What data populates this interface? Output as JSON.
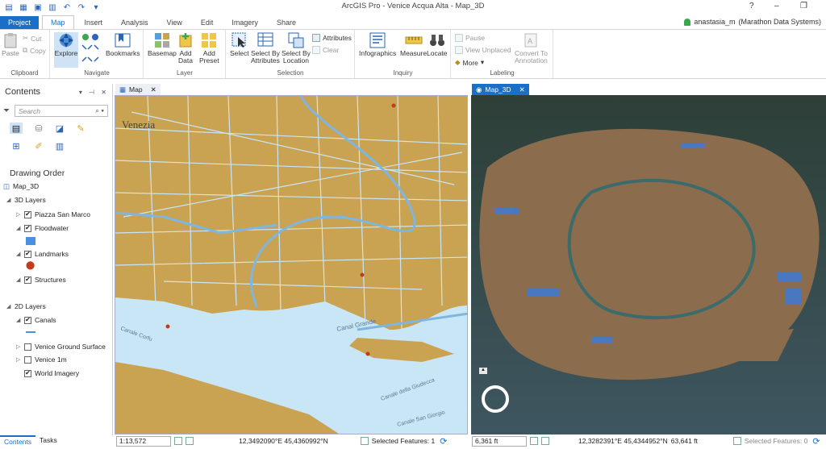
{
  "window": {
    "title": "ArcGIS Pro - Venice Acqua Alta - Map_3D",
    "help": "?",
    "minimize": "–",
    "restore": "❐"
  },
  "ribbon_tabs": [
    "Project",
    "Map",
    "Insert",
    "Analysis",
    "View",
    "Edit",
    "Imagery",
    "Share"
  ],
  "active_tab": "Map",
  "user": {
    "name": "anastasia_m",
    "org": "Marathon Data Systems"
  },
  "clipboard": {
    "paste": "Paste",
    "cut": "Cut",
    "copy": "Copy",
    "label": "Clipboard"
  },
  "navigate": {
    "explore": "Explore",
    "bookmarks": "Bookmarks",
    "label": "Navigate"
  },
  "layer": {
    "basemap": "Basemap",
    "add_data_1": "Add",
    "add_data_2": "Data",
    "add_preset_1": "Add",
    "add_preset_2": "Preset",
    "label": "Layer"
  },
  "selection": {
    "select": "Select",
    "select_by_attr_1": "Select By",
    "select_by_attr_2": "Attributes",
    "select_by_loc_1": "Select By",
    "select_by_loc_2": "Location",
    "attributes": "Attributes",
    "clear": "Clear",
    "label": "Selection"
  },
  "inquiry": {
    "infographics": "Infographics",
    "measure": "Measure",
    "locate": "Locate",
    "label": "Inquiry"
  },
  "labeling": {
    "pause": "Pause",
    "view_unplaced": "View Unplaced",
    "more": "More",
    "convert_1": "Convert To",
    "convert_2": "Annotation",
    "label": "Labeling"
  },
  "contents": {
    "title": "Contents",
    "search_placeholder": "Search",
    "drawing_order": "Drawing Order",
    "map_name": "Map_3D",
    "section_3d": "3D Layers",
    "section_2d": "2D Layers",
    "layers_3d": [
      "Piazza San Marco",
      "Floodwater",
      "Landmarks",
      "Structures"
    ],
    "layers_2d": [
      "Canals",
      "Venice Ground Surface",
      "Venice 1m",
      "World Imagery"
    ],
    "tab_contents": "Contents",
    "tab_tasks": "Tasks"
  },
  "map2d": {
    "tab": "Map",
    "label_venezia": "Venezia",
    "label_canal_grande": "Canal Grande",
    "label_canale_corfu": "Canale Corfu",
    "label_canale_giudecca": "Canale della Giudecca",
    "label_canale_san_giorgio": "Canale San Giorgio",
    "scale": "1:13,572",
    "coords": "12,3492090°E 45,4360992°N",
    "selected": "Selected Features: 1"
  },
  "map3d": {
    "tab": "Map_3D",
    "altitude": "6,361 ft",
    "coords": "12,3282391°E 45,4344952°N",
    "elevation": "63,641 ft",
    "selected": "Selected Features: 0"
  },
  "colors": {
    "accent": "#1a6fc6",
    "land": "#c9a252",
    "water": "#c9e6f6",
    "canal": "#7fb6e0"
  }
}
